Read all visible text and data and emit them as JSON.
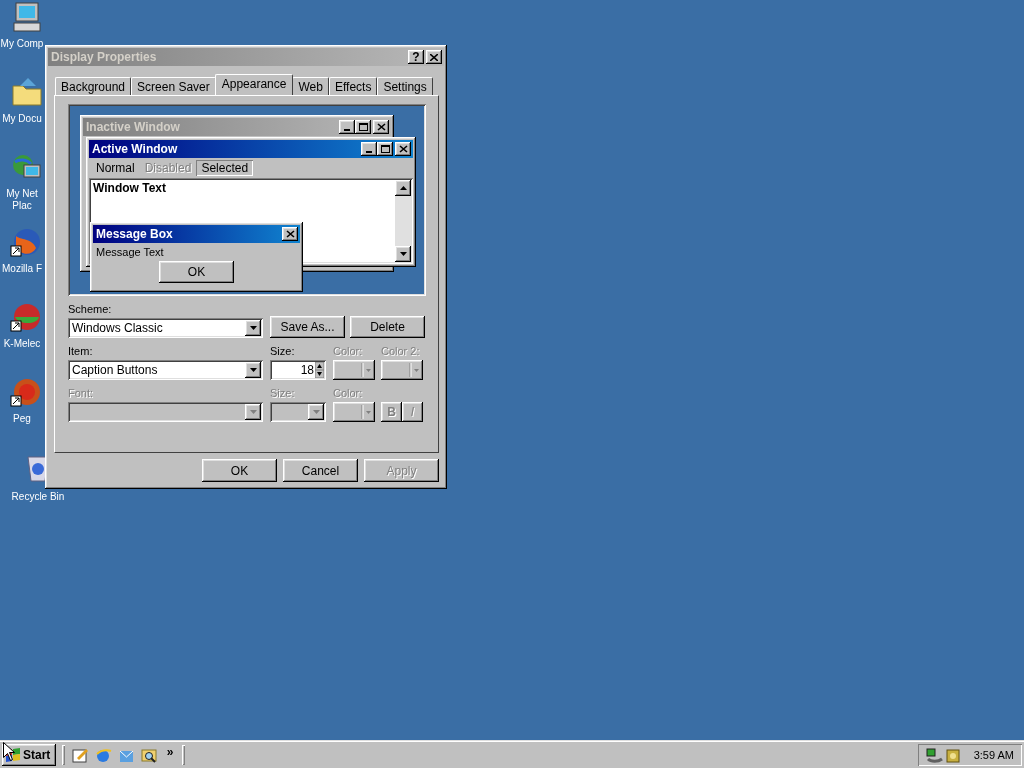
{
  "desktop_icons": [
    {
      "label": "My Comp",
      "kind": "computer",
      "shortcut": false
    },
    {
      "label": "My Docu",
      "kind": "documents",
      "shortcut": false
    },
    {
      "label": "My Net Plac",
      "kind": "network",
      "shortcut": false
    },
    {
      "label": "Mozilla F",
      "kind": "browser",
      "shortcut": true
    },
    {
      "label": "K-Melec",
      "kind": "melon",
      "shortcut": true
    },
    {
      "label": "Peg",
      "kind": "mail",
      "shortcut": true
    },
    {
      "label": "Recycle Bin",
      "kind": "recycle",
      "shortcut": false
    }
  ],
  "dialog": {
    "title": "Display Properties",
    "help": "?",
    "tabs": [
      {
        "label": "Background",
        "selected": false
      },
      {
        "label": "Screen Saver",
        "selected": false
      },
      {
        "label": "Appearance",
        "selected": true
      },
      {
        "label": "Web",
        "selected": false
      },
      {
        "label": "Effects",
        "selected": false
      },
      {
        "label": "Settings",
        "selected": false
      }
    ],
    "preview": {
      "inactive_title": "Inactive Window",
      "active_title": "Active Window",
      "menu": [
        {
          "label": "Normal",
          "disabled": false,
          "selected": false
        },
        {
          "label": "Disabled",
          "disabled": true,
          "selected": false
        },
        {
          "label": "Selected",
          "disabled": false,
          "selected": true
        }
      ],
      "window_text": "Window Text",
      "message_box": {
        "title": "Message Box",
        "text": "Message Text",
        "button": "OK"
      }
    },
    "scheme": {
      "label": "Scheme:",
      "value": "Windows Classic",
      "buttons": [
        {
          "label": "Save As...",
          "disabled": false
        },
        {
          "label": "Delete",
          "disabled": false
        }
      ]
    },
    "item_row": [
      {
        "label": "Item:",
        "kind": "combo",
        "value": "Caption Buttons",
        "disabled": false
      },
      {
        "label": "Size:",
        "kind": "spin",
        "value": "18",
        "disabled": false
      },
      {
        "label": "Color:",
        "kind": "color",
        "disabled": true
      },
      {
        "label": "Color 2:",
        "kind": "color",
        "disabled": true
      }
    ],
    "font_row": [
      {
        "label": "Font:",
        "kind": "combo",
        "disabled": true
      },
      {
        "label": "Size:",
        "kind": "small-combo",
        "disabled": true
      },
      {
        "label": "Color:",
        "kind": "color",
        "disabled": true
      }
    ],
    "style_buttons": [
      {
        "label": "B",
        "kind": "bold",
        "disabled": true
      },
      {
        "label": "I",
        "kind": "italic",
        "disabled": true
      }
    ],
    "footer_buttons": [
      {
        "label": "OK",
        "disabled": false
      },
      {
        "label": "Cancel",
        "disabled": false
      },
      {
        "label": "Apply",
        "disabled": true
      }
    ]
  },
  "taskbar": {
    "start": "Start",
    "quick_launch": [
      {
        "kind": "desktop"
      },
      {
        "kind": "browser"
      },
      {
        "kind": "mail"
      },
      {
        "kind": "search"
      }
    ],
    "more": "»",
    "tray": [
      {
        "kind": "network"
      },
      {
        "kind": "app"
      }
    ],
    "clock": "3:59 AM"
  }
}
